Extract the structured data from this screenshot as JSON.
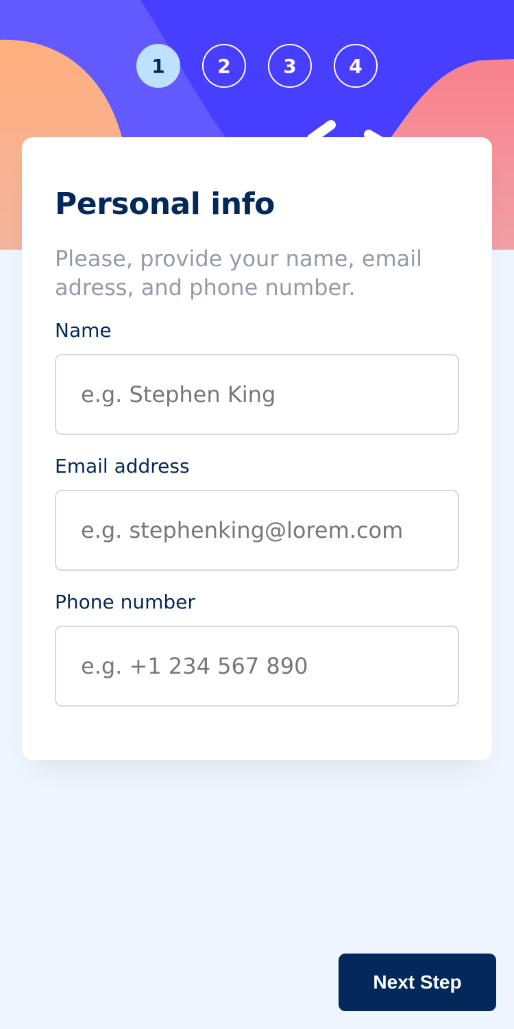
{
  "colors": {
    "header_blue": "#483eff",
    "orange_blob": "#ffaf7e",
    "pink_blob": "#f9818e",
    "active_step": "#bee2fd",
    "marine_blue": "#022959",
    "cool_gray": "#9699aa",
    "border": "#d6d9e6",
    "background": "#eff5ff"
  },
  "steps": [
    {
      "number": "1",
      "active": true
    },
    {
      "number": "2",
      "active": false
    },
    {
      "number": "3",
      "active": false
    },
    {
      "number": "4",
      "active": false
    }
  ],
  "form": {
    "title": "Personal info",
    "subtitle": "Please, provide your name, email adress, and phone number.",
    "fields": {
      "name": {
        "label": "Name",
        "placeholder": "e.g. Stephen King",
        "value": ""
      },
      "email": {
        "label": "Email address",
        "placeholder": "e.g. stephenking@lorem.com",
        "value": ""
      },
      "phone": {
        "label": "Phone number",
        "placeholder": "e.g. +1 234 567 890",
        "value": ""
      }
    }
  },
  "footer": {
    "next_label": "Next Step"
  }
}
